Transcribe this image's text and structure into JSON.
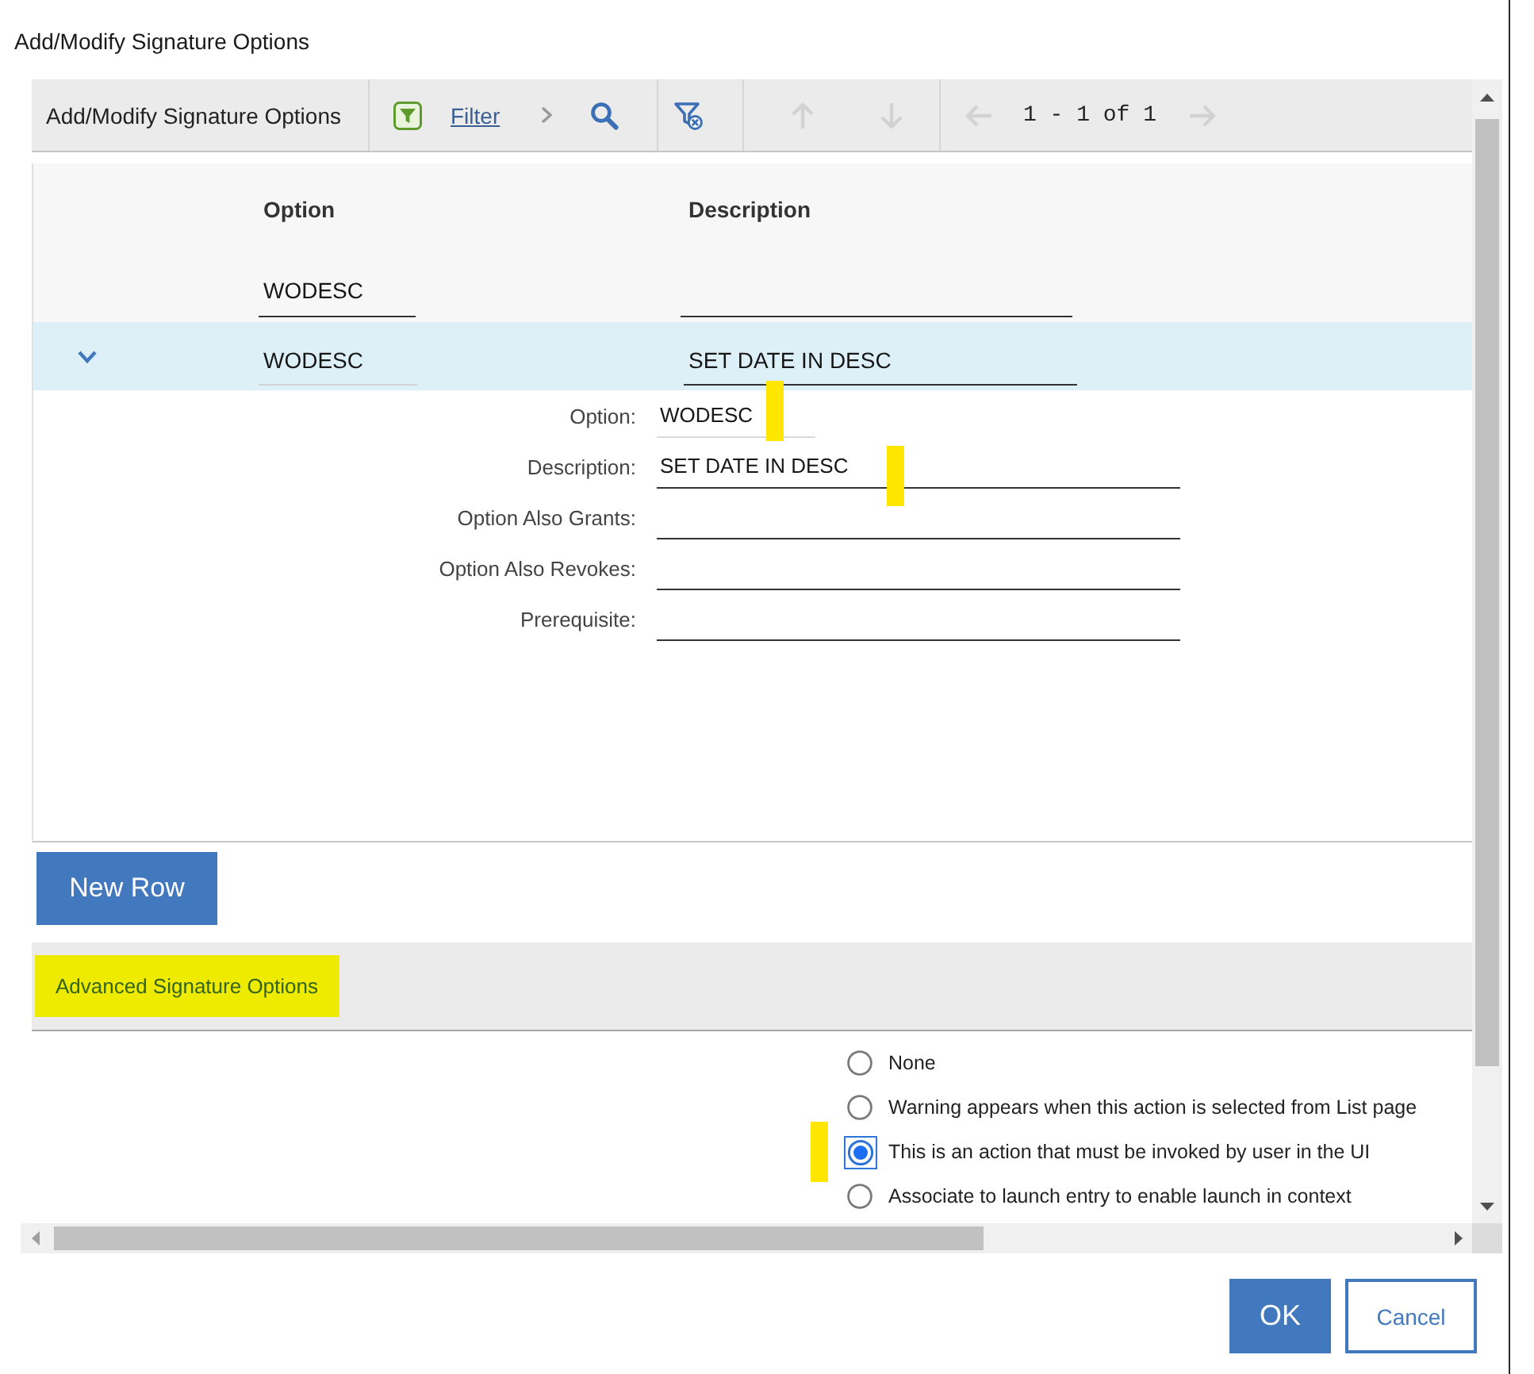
{
  "dialog": {
    "title": "Add/Modify Signature Options"
  },
  "toolbar": {
    "title": "Add/Modify Signature Options",
    "filter_link": "Filter",
    "row_nav_disabled": true,
    "page_info": "1 - 1 of 1",
    "page_nav_disabled": true
  },
  "table": {
    "columns": [
      {
        "label": "Option",
        "filter": "WODESC"
      },
      {
        "label": "Description"
      }
    ],
    "rows": [
      {
        "selected": true,
        "expanded": true,
        "cells": [
          {
            "value": "WODESC",
            "readonly": true
          },
          {
            "value": "SET DATE IN DESC",
            "readonly": false
          }
        ],
        "details": [
          {
            "label": "Option:",
            "value": "WODESC",
            "readonly": true,
            "marked": true
          },
          {
            "label": "Description:",
            "value": "SET DATE IN DESC",
            "readonly": false,
            "marked": true
          },
          {
            "label": "Option Also Grants:",
            "readonly": false,
            "marked": false
          },
          {
            "label": "Option Also Revokes:",
            "readonly": false,
            "marked": false
          },
          {
            "label": "Prerequisite:",
            "readonly": false,
            "marked": false
          }
        ]
      }
    ]
  },
  "new_row_button": "New Row",
  "advanced": {
    "title": "Advanced Signature Options",
    "highlighted": true,
    "options": [
      {
        "label": "None",
        "selected": false,
        "marked": false
      },
      {
        "label": "Warning appears when this action is selected from List page",
        "selected": false,
        "marked": false
      },
      {
        "label": "This is an action that must be invoked by user in the UI",
        "selected": true,
        "marked": true
      },
      {
        "label": "Associate to launch entry to enable launch in context",
        "selected": false,
        "marked": false
      }
    ]
  },
  "buttons": [
    {
      "label": "OK",
      "kind": "primary"
    },
    {
      "label": "Cancel",
      "kind": "secondary"
    }
  ]
}
